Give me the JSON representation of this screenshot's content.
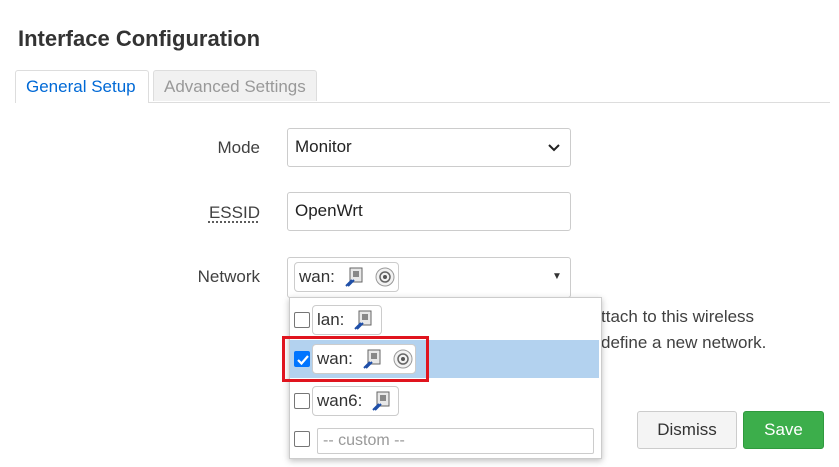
{
  "page": {
    "title": "Interface Configuration"
  },
  "tabs": [
    {
      "label": "General Setup",
      "active": true
    },
    {
      "label": "Advanced Settings",
      "active": false
    }
  ],
  "form": {
    "mode": {
      "label": "Mode",
      "value": "Monitor"
    },
    "essid": {
      "label": "ESSID",
      "value": "OpenWrt"
    },
    "network": {
      "label": "Network",
      "selected_chip": "wan:",
      "description_line1": "ttach to this wireless",
      "description_line2": "define a new network."
    }
  },
  "dropdown": {
    "items": [
      {
        "label": "lan:",
        "checked": false,
        "icons": [
          "ethernet-icon"
        ]
      },
      {
        "label": "wan:",
        "checked": true,
        "icons": [
          "ethernet-icon",
          "wireless-icon"
        ]
      },
      {
        "label": "wan6:",
        "checked": false,
        "icons": [
          "ethernet-icon"
        ]
      }
    ],
    "custom_placeholder": "-- custom --"
  },
  "buttons": {
    "dismiss": "Dismiss",
    "save": "Save"
  },
  "colors": {
    "accent": "#0069d6",
    "save_green": "#3cae4b",
    "highlight_red": "#e0141e",
    "selection": "#b3d2ef"
  }
}
